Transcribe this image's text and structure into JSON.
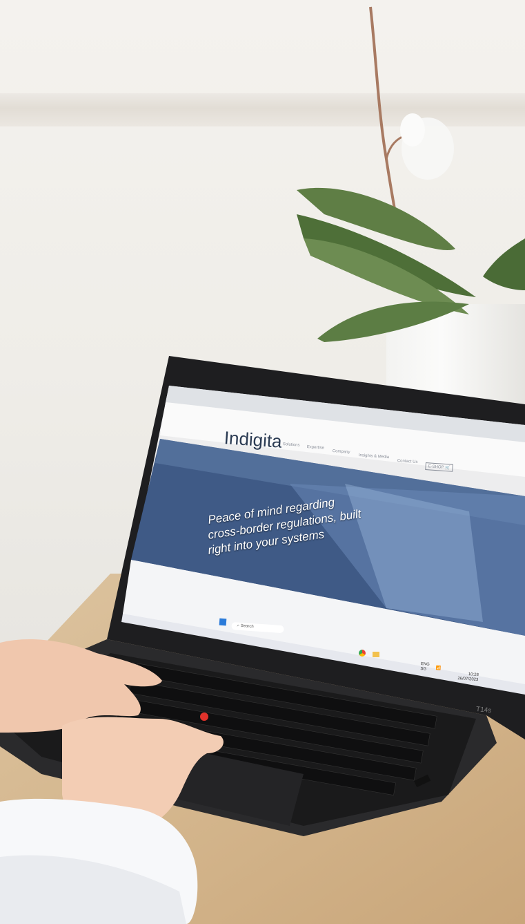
{
  "website": {
    "logo": "Indigita",
    "nav": [
      "Solutions",
      "Expertise",
      "Company",
      "Insights & Media",
      "Contact Us"
    ],
    "eshop_label": "E-SHOP",
    "hero_text": [
      "Peace of mind regarding",
      "cross-border regulations, built",
      "right into your systems"
    ]
  },
  "taskbar": {
    "search_placeholder": "Search",
    "language": "ENG",
    "region": "SG",
    "time": "10:28",
    "date": "26/07/2023"
  },
  "laptop": {
    "model": "T14s"
  },
  "colors": {
    "wall": "#efece6",
    "desk": "#d2b48c",
    "laptop_body": "#2b2b2d",
    "screen_hero": "#3f5a86",
    "trackpoint": "#e0322b"
  }
}
